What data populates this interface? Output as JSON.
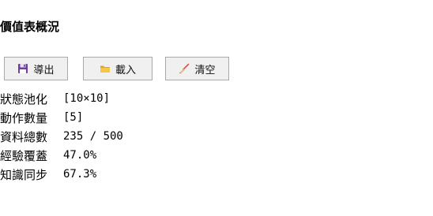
{
  "page": {
    "title": "價值表概況"
  },
  "toolbar": {
    "export_label": "導出",
    "export_icon": "floppy-disk-icon",
    "load_label": "載入",
    "load_icon": "folder-icon",
    "clear_label": "清空",
    "clear_icon": "broom-icon"
  },
  "stats": [
    {
      "label": "狀態池化",
      "value": "[10×10]"
    },
    {
      "label": "動作數量",
      "value": "[5]"
    },
    {
      "label": "資料總數",
      "value": "235 / 500"
    },
    {
      "label": "經驗覆蓋",
      "value": "47.0%"
    },
    {
      "label": "知識同步",
      "value": "67.3%"
    }
  ],
  "colors": {
    "button_bg": "#f0f0f0",
    "button_border": "#a9a9a9",
    "folder": "#f2b630",
    "floppy": "#6a3fa0",
    "broom_handle": "#d9534f"
  }
}
